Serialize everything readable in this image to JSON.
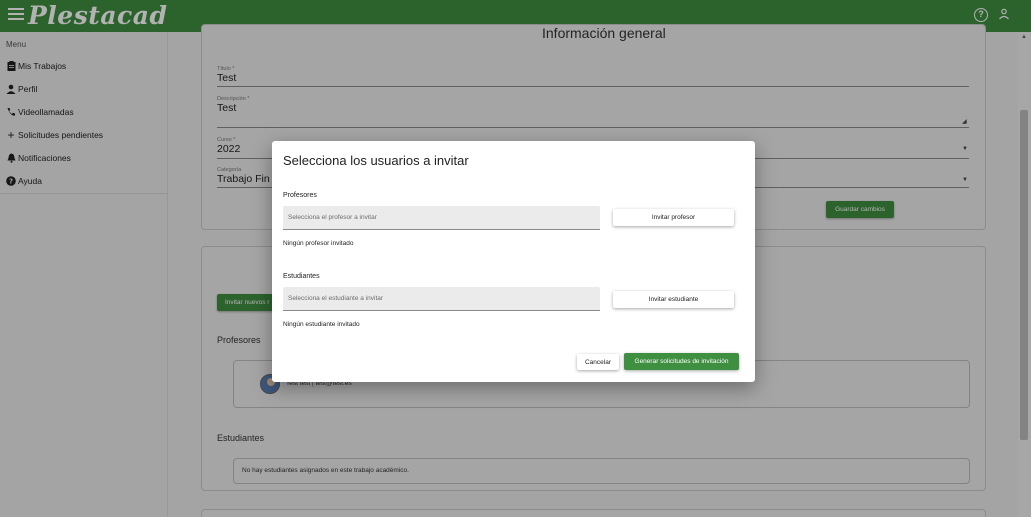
{
  "app": {
    "brand": "Plestacad",
    "colors": {
      "primary": "#3f8f41",
      "background": "#ebebeb",
      "dialog": "#ffffff"
    },
    "top_icons": [
      "help-icon",
      "user-icon"
    ]
  },
  "sidebar": {
    "menu_label": "Menu",
    "items": [
      {
        "label": "Mis Trabajos",
        "icon": "clipboard-icon"
      },
      {
        "label": "Perfil",
        "icon": "person-icon"
      },
      {
        "label": "Videollamadas",
        "icon": "phone-icon"
      },
      {
        "label": "Solicitudes pendientes",
        "icon": "plus-icon"
      },
      {
        "label": "Notificaciones",
        "icon": "bell-icon"
      },
      {
        "label": "Ayuda",
        "icon": "help-icon"
      }
    ]
  },
  "general_info": {
    "title": "Información general",
    "fields": {
      "titulo": {
        "label": "Título *",
        "value": "Test"
      },
      "descripcion": {
        "label": "Descripción *",
        "value": "Test"
      },
      "curso": {
        "label": "Curso *",
        "value": "2022"
      },
      "categoria": {
        "label": "Categoría",
        "value": "Trabajo Fin d"
      }
    },
    "save_button": "Guardar cambios"
  },
  "members": {
    "invite_button": "Invitar nuevos r",
    "professors_title": "Profesores",
    "professor_entry": "Test test | test@test.es",
    "students_title": "Estudiantes",
    "no_students": "No hay estudiantes asignados en este trabajo académico."
  },
  "dialog": {
    "title": "Selecciona los usuarios a invitar",
    "professors": {
      "label": "Profesores",
      "placeholder": "Selecciona el profesor a invitar",
      "button": "Invitar profesor",
      "empty": "Ningún profesor invitado"
    },
    "students": {
      "label": "Estudiantes",
      "placeholder": "Selecciona el estudiante a invitar",
      "button": "Invitar estudiante",
      "empty": "Ningún estudiante invitado"
    },
    "cancel": "Cancelar",
    "submit": "Generar solicitudes de invitación"
  }
}
